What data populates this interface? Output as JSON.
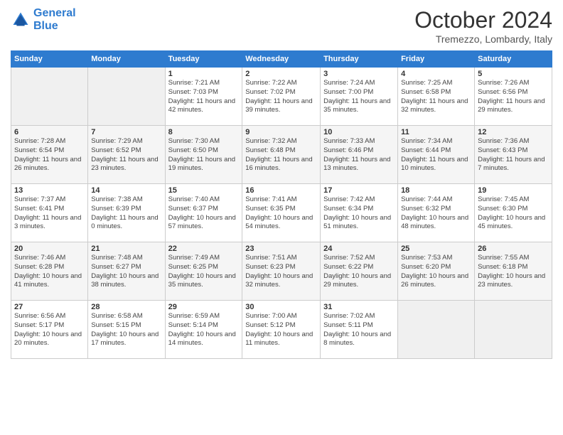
{
  "header": {
    "logo_line1": "General",
    "logo_line2": "Blue",
    "month": "October 2024",
    "location": "Tremezzo, Lombardy, Italy"
  },
  "days_of_week": [
    "Sunday",
    "Monday",
    "Tuesday",
    "Wednesday",
    "Thursday",
    "Friday",
    "Saturday"
  ],
  "weeks": [
    [
      {
        "num": "",
        "info": ""
      },
      {
        "num": "",
        "info": ""
      },
      {
        "num": "1",
        "info": "Sunrise: 7:21 AM\nSunset: 7:03 PM\nDaylight: 11 hours and 42 minutes."
      },
      {
        "num": "2",
        "info": "Sunrise: 7:22 AM\nSunset: 7:02 PM\nDaylight: 11 hours and 39 minutes."
      },
      {
        "num": "3",
        "info": "Sunrise: 7:24 AM\nSunset: 7:00 PM\nDaylight: 11 hours and 35 minutes."
      },
      {
        "num": "4",
        "info": "Sunrise: 7:25 AM\nSunset: 6:58 PM\nDaylight: 11 hours and 32 minutes."
      },
      {
        "num": "5",
        "info": "Sunrise: 7:26 AM\nSunset: 6:56 PM\nDaylight: 11 hours and 29 minutes."
      }
    ],
    [
      {
        "num": "6",
        "info": "Sunrise: 7:28 AM\nSunset: 6:54 PM\nDaylight: 11 hours and 26 minutes."
      },
      {
        "num": "7",
        "info": "Sunrise: 7:29 AM\nSunset: 6:52 PM\nDaylight: 11 hours and 23 minutes."
      },
      {
        "num": "8",
        "info": "Sunrise: 7:30 AM\nSunset: 6:50 PM\nDaylight: 11 hours and 19 minutes."
      },
      {
        "num": "9",
        "info": "Sunrise: 7:32 AM\nSunset: 6:48 PM\nDaylight: 11 hours and 16 minutes."
      },
      {
        "num": "10",
        "info": "Sunrise: 7:33 AM\nSunset: 6:46 PM\nDaylight: 11 hours and 13 minutes."
      },
      {
        "num": "11",
        "info": "Sunrise: 7:34 AM\nSunset: 6:44 PM\nDaylight: 11 hours and 10 minutes."
      },
      {
        "num": "12",
        "info": "Sunrise: 7:36 AM\nSunset: 6:43 PM\nDaylight: 11 hours and 7 minutes."
      }
    ],
    [
      {
        "num": "13",
        "info": "Sunrise: 7:37 AM\nSunset: 6:41 PM\nDaylight: 11 hours and 3 minutes."
      },
      {
        "num": "14",
        "info": "Sunrise: 7:38 AM\nSunset: 6:39 PM\nDaylight: 11 hours and 0 minutes."
      },
      {
        "num": "15",
        "info": "Sunrise: 7:40 AM\nSunset: 6:37 PM\nDaylight: 10 hours and 57 minutes."
      },
      {
        "num": "16",
        "info": "Sunrise: 7:41 AM\nSunset: 6:35 PM\nDaylight: 10 hours and 54 minutes."
      },
      {
        "num": "17",
        "info": "Sunrise: 7:42 AM\nSunset: 6:34 PM\nDaylight: 10 hours and 51 minutes."
      },
      {
        "num": "18",
        "info": "Sunrise: 7:44 AM\nSunset: 6:32 PM\nDaylight: 10 hours and 48 minutes."
      },
      {
        "num": "19",
        "info": "Sunrise: 7:45 AM\nSunset: 6:30 PM\nDaylight: 10 hours and 45 minutes."
      }
    ],
    [
      {
        "num": "20",
        "info": "Sunrise: 7:46 AM\nSunset: 6:28 PM\nDaylight: 10 hours and 41 minutes."
      },
      {
        "num": "21",
        "info": "Sunrise: 7:48 AM\nSunset: 6:27 PM\nDaylight: 10 hours and 38 minutes."
      },
      {
        "num": "22",
        "info": "Sunrise: 7:49 AM\nSunset: 6:25 PM\nDaylight: 10 hours and 35 minutes."
      },
      {
        "num": "23",
        "info": "Sunrise: 7:51 AM\nSunset: 6:23 PM\nDaylight: 10 hours and 32 minutes."
      },
      {
        "num": "24",
        "info": "Sunrise: 7:52 AM\nSunset: 6:22 PM\nDaylight: 10 hours and 29 minutes."
      },
      {
        "num": "25",
        "info": "Sunrise: 7:53 AM\nSunset: 6:20 PM\nDaylight: 10 hours and 26 minutes."
      },
      {
        "num": "26",
        "info": "Sunrise: 7:55 AM\nSunset: 6:18 PM\nDaylight: 10 hours and 23 minutes."
      }
    ],
    [
      {
        "num": "27",
        "info": "Sunrise: 6:56 AM\nSunset: 5:17 PM\nDaylight: 10 hours and 20 minutes."
      },
      {
        "num": "28",
        "info": "Sunrise: 6:58 AM\nSunset: 5:15 PM\nDaylight: 10 hours and 17 minutes."
      },
      {
        "num": "29",
        "info": "Sunrise: 6:59 AM\nSunset: 5:14 PM\nDaylight: 10 hours and 14 minutes."
      },
      {
        "num": "30",
        "info": "Sunrise: 7:00 AM\nSunset: 5:12 PM\nDaylight: 10 hours and 11 minutes."
      },
      {
        "num": "31",
        "info": "Sunrise: 7:02 AM\nSunset: 5:11 PM\nDaylight: 10 hours and 8 minutes."
      },
      {
        "num": "",
        "info": ""
      },
      {
        "num": "",
        "info": ""
      }
    ]
  ]
}
